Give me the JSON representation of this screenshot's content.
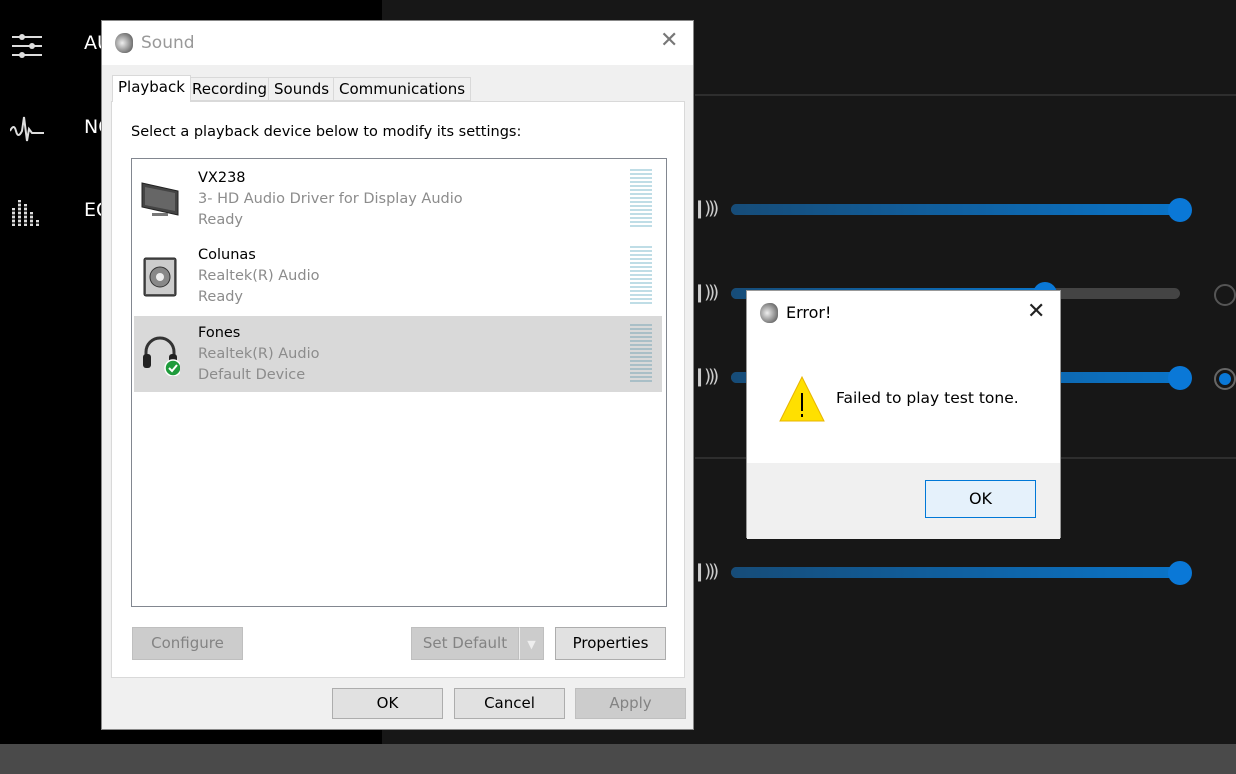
{
  "background_app": {
    "nav": [
      {
        "label": "AU",
        "icon": "sliders-icon"
      },
      {
        "label": "NO",
        "icon": "waveform-icon"
      },
      {
        "label": "EQ",
        "icon": "equalizer-icon"
      }
    ],
    "sliders": [
      {
        "value_percent": 100
      },
      {
        "value_percent": 70
      },
      {
        "value_percent": 100
      },
      {
        "value_percent": 100
      }
    ],
    "radios": [
      {
        "checked": false
      },
      {
        "checked": true
      }
    ],
    "accent_color": "#0a78d7"
  },
  "sound_dialog": {
    "title": "Sound",
    "tabs": [
      "Playback",
      "Recording",
      "Sounds",
      "Communications"
    ],
    "active_tab": "Playback",
    "hint": "Select a playback device below to modify its settings:",
    "devices": [
      {
        "name": "VX238",
        "driver": "3- HD Audio Driver for Display Audio",
        "status": "Ready",
        "icon": "monitor-icon"
      },
      {
        "name": "Colunas",
        "driver": "Realtek(R) Audio",
        "status": "Ready",
        "icon": "speaker-icon"
      },
      {
        "name": "Fones",
        "driver": "Realtek(R) Audio",
        "status": "Default Device",
        "icon": "headphones-icon",
        "selected": true,
        "default": true
      }
    ],
    "buttons": {
      "configure": "Configure",
      "set_default": "Set Default",
      "properties": "Properties",
      "ok": "OK",
      "cancel": "Cancel",
      "apply": "Apply"
    }
  },
  "error_dialog": {
    "title": "Error!",
    "message": "Failed to play test tone.",
    "ok": "OK",
    "icon": "warning-icon"
  }
}
